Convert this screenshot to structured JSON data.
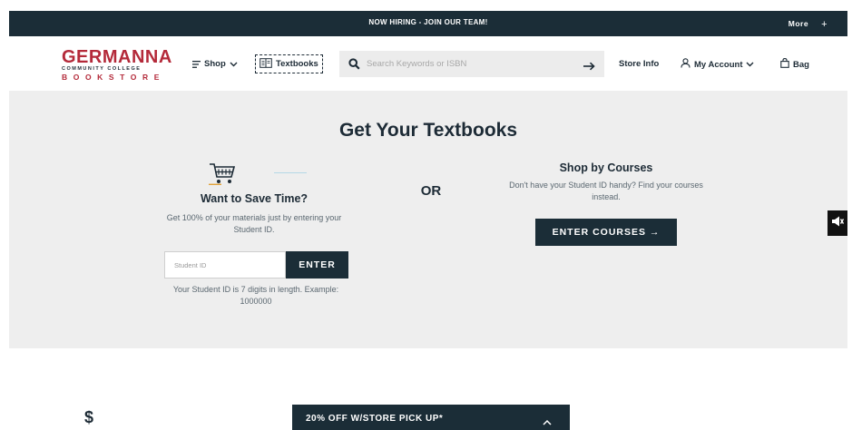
{
  "announcement": {
    "message": "NOW HIRING - JOIN OUR TEAM!",
    "more_label": "More",
    "more_plus": "+"
  },
  "header": {
    "logo": {
      "line1": "GERMANNA",
      "line2": "COMMUNITY COLLEGE",
      "line3": "BOOKSTORE"
    },
    "nav": {
      "shop_label": "Shop",
      "textbooks_label": "Textbooks",
      "store_info_label": "Store Info",
      "account_label": "My Account",
      "bag_label": "Bag"
    },
    "search": {
      "placeholder": "Search Keywords or ISBN",
      "value": ""
    }
  },
  "hero": {
    "title": "Get Your Textbooks",
    "student_id": {
      "title": "Want to Save Time?",
      "description": "Get 100% of your materials just by entering your Student ID.",
      "input_placeholder": "Student ID",
      "input_value": "",
      "button_label": "ENTER",
      "note": "Your Student ID is 7 digits in length. Example: 1000000"
    },
    "or_label": "OR",
    "courses": {
      "title": "Shop by Courses",
      "description": "Don't have your Student ID handy? Find your courses instead.",
      "button_label": "ENTER COURSES →"
    }
  },
  "promo": {
    "label": "20% OFF W/STORE PICK UP*",
    "dollar_symbol": "$"
  },
  "colors": {
    "navy": "#1b2d37",
    "brand_red": "#b42a3a",
    "hero_bg": "#eeeeee",
    "search_bg": "#ececec"
  },
  "icons": {
    "menu": "hamburger-icon",
    "textbooks": "book-icon",
    "search": "search-icon",
    "submit": "arrow-right-icon",
    "account": "user-icon",
    "bag": "bag-icon",
    "cart": "cart-icon",
    "accessibility": "speaker-icon"
  }
}
